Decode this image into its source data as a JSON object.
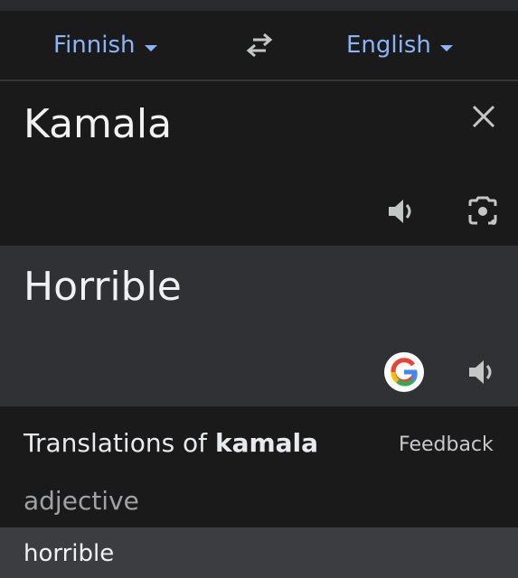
{
  "languages": {
    "source": "Finnish",
    "target": "English"
  },
  "input": {
    "text": "Kamala"
  },
  "output": {
    "text": "Horrible"
  },
  "dictionary": {
    "title_prefix": "Translations of ",
    "title_word": "kamala",
    "feedback_label": "Feedback",
    "part_of_speech": "adjective",
    "entries": [
      "horrible"
    ]
  },
  "icons": {
    "swap": "swap-arrows-icon",
    "clear": "close-icon",
    "speak": "speaker-icon",
    "camera": "camera-icon",
    "google": "google-g-icon",
    "caret": "caret-down-icon"
  },
  "colors": {
    "accent": "#8ab4f8",
    "background": "#1a1a1a",
    "output_background": "#303134",
    "icon": "#c4c7c5"
  }
}
